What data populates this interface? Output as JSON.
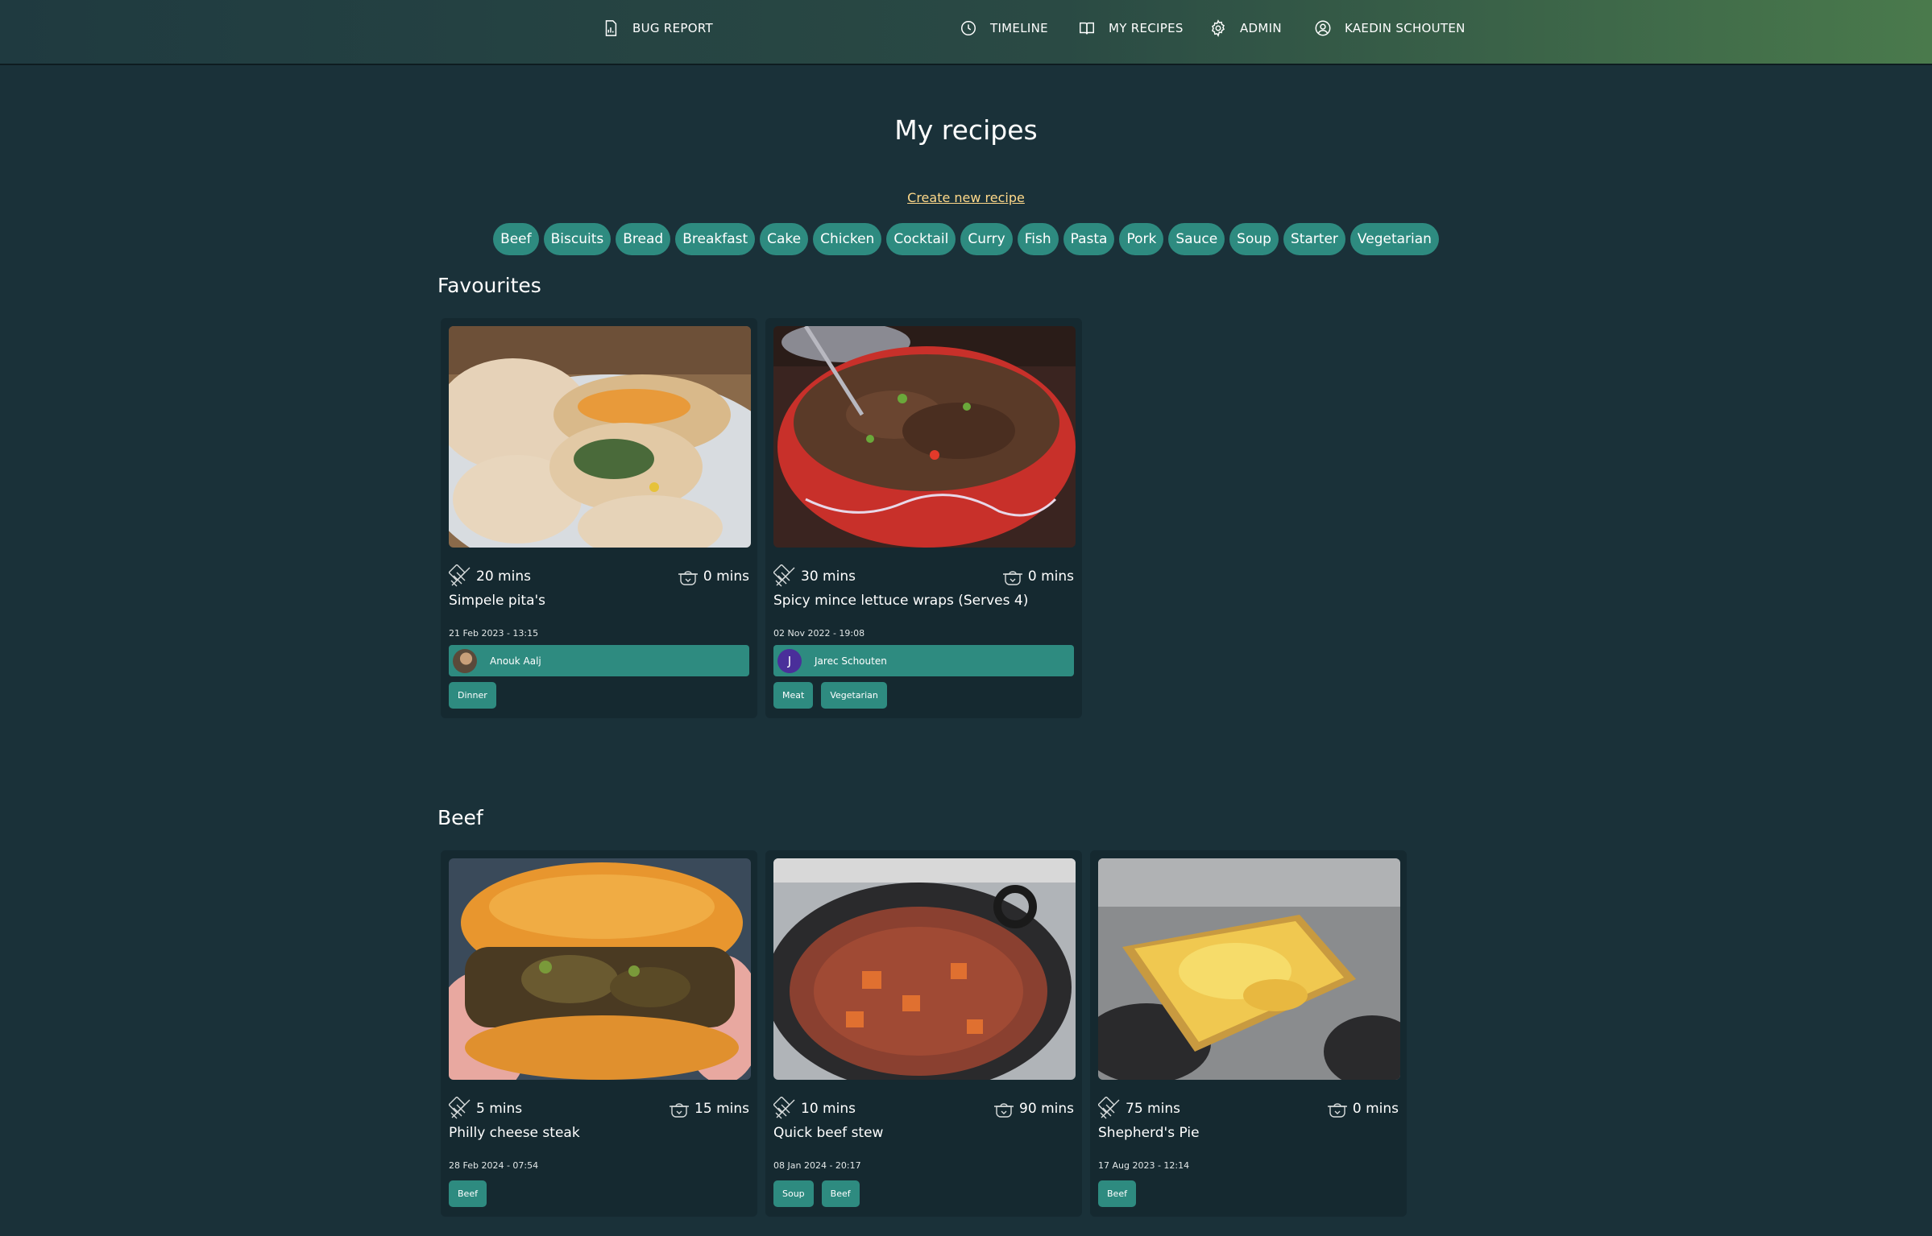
{
  "nav": {
    "bug_report": "BUG REPORT",
    "timeline": "TIMELINE",
    "my_recipes": "MY RECIPES",
    "admin": "ADMIN",
    "user": "KAEDIN SCHOUTEN"
  },
  "page": {
    "title": "My recipes",
    "create_link": "Create new recipe"
  },
  "categories": [
    "Beef",
    "Biscuits",
    "Bread",
    "Breakfast",
    "Cake",
    "Chicken",
    "Cocktail",
    "Curry",
    "Fish",
    "Pasta",
    "Pork",
    "Sauce",
    "Soup",
    "Starter",
    "Vegetarian"
  ],
  "favourites": {
    "title": "Favourites",
    "cards": [
      {
        "prep": "20 mins",
        "cook": "0 mins",
        "title": "Simpele pita's",
        "date": "21 Feb 2023 - 13:15",
        "author": "Anouk Aalj",
        "tags": [
          "Dinner"
        ]
      },
      {
        "prep": "30 mins",
        "cook": "0 mins",
        "title": "Spicy mince lettuce wraps (Serves 4)",
        "date": "02 Nov 2022 - 19:08",
        "author": "Jarec Schouten",
        "author_initial": "J",
        "tags": [
          "Meat",
          "Vegetarian"
        ]
      }
    ]
  },
  "beef": {
    "title": "Beef",
    "cards": [
      {
        "prep": "5 mins",
        "cook": "15 mins",
        "title": "Philly cheese steak",
        "date": "28 Feb 2024 - 07:54",
        "tags": [
          "Beef"
        ]
      },
      {
        "prep": "10 mins",
        "cook": "90 mins",
        "title": "Quick beef stew",
        "date": "08 Jan 2024 - 20:17",
        "tags": [
          "Soup",
          "Beef"
        ]
      },
      {
        "prep": "75 mins",
        "cook": "0 mins",
        "title": "Shepherd's Pie",
        "date": "17 Aug 2023 - 12:14",
        "tags": [
          "Beef"
        ]
      }
    ]
  },
  "colors": {
    "background": "#1a3139",
    "accent": "#2e8b80",
    "link": "#ffd98a",
    "card": "#152930"
  }
}
